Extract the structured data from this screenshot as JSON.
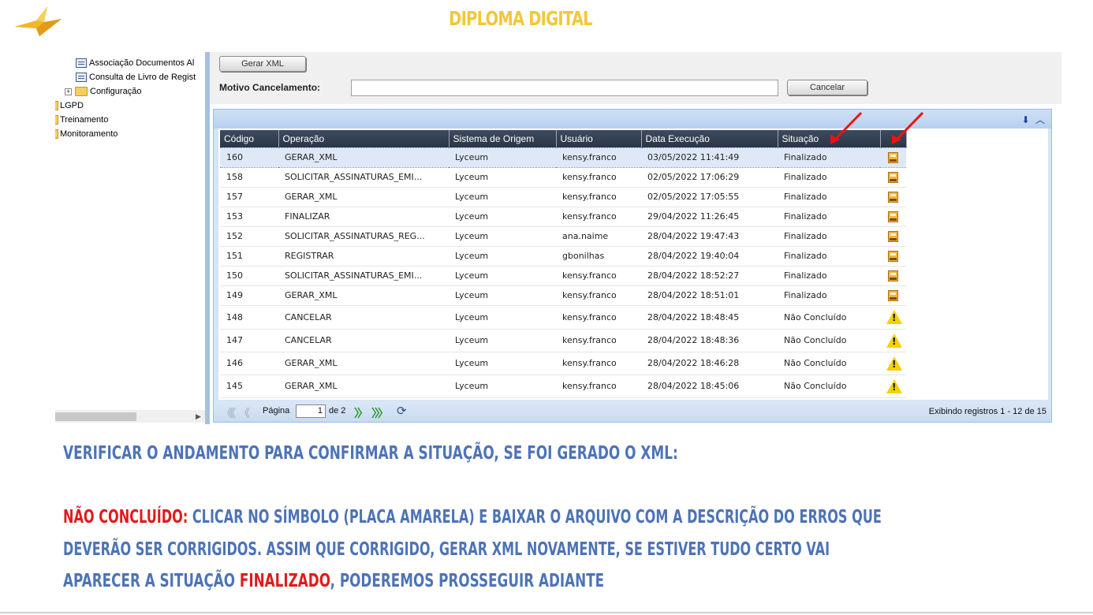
{
  "slide": {
    "title": "DIPLOMA DIGITAL",
    "logo_icon": "bird-icon",
    "title_color": "#f3c738",
    "text_color": "#4d73b8",
    "highlight_color": "#e01b1b"
  },
  "sidebar": {
    "items": [
      {
        "label": "Associação Documentos Al",
        "icon": "document-list-icon"
      },
      {
        "label": "Consulta de Livro de Regist",
        "icon": "document-list-icon"
      },
      {
        "label": "Configuração",
        "icon": "folder-icon"
      },
      {
        "label": "LGPD",
        "icon": "folder-icon"
      },
      {
        "label": "Treinamento",
        "icon": "folder-icon"
      },
      {
        "label": "Monitoramento",
        "icon": "folder-icon"
      }
    ]
  },
  "form": {
    "gerar_xml_label": "Gerar XML",
    "motivo_label": "Motivo Cancelamento:",
    "motivo_value": "",
    "cancelar_label": "Cancelar"
  },
  "grid": {
    "columns": [
      "Código",
      "Operação",
      "Sistema de Origem",
      "Usuário",
      "Data Execução",
      "Situação",
      ""
    ],
    "rows": [
      {
        "codigo": "160",
        "operacao": "GERAR_XML",
        "sistema": "Lyceum",
        "usuario": "kensy.franco",
        "data": "03/05/2022 11:41:49",
        "situacao": "Finalizado",
        "icon": "save-file-icon"
      },
      {
        "codigo": "158",
        "operacao": "SOLICITAR_ASSINATURAS_EMI...",
        "sistema": "Lyceum",
        "usuario": "kensy.franco",
        "data": "02/05/2022 17:06:29",
        "situacao": "Finalizado",
        "icon": "save-file-icon"
      },
      {
        "codigo": "157",
        "operacao": "GERAR_XML",
        "sistema": "Lyceum",
        "usuario": "kensy.franco",
        "data": "02/05/2022 17:05:55",
        "situacao": "Finalizado",
        "icon": "save-file-icon"
      },
      {
        "codigo": "153",
        "operacao": "FINALIZAR",
        "sistema": "Lyceum",
        "usuario": "kensy.franco",
        "data": "29/04/2022 11:26:45",
        "situacao": "Finalizado",
        "icon": "save-file-icon"
      },
      {
        "codigo": "152",
        "operacao": "SOLICITAR_ASSINATURAS_REG...",
        "sistema": "Lyceum",
        "usuario": "ana.naime",
        "data": "28/04/2022 19:47:43",
        "situacao": "Finalizado",
        "icon": "save-file-icon"
      },
      {
        "codigo": "151",
        "operacao": "REGISTRAR",
        "sistema": "Lyceum",
        "usuario": "gbonilhas",
        "data": "28/04/2022 19:40:04",
        "situacao": "Finalizado",
        "icon": "save-file-icon"
      },
      {
        "codigo": "150",
        "operacao": "SOLICITAR_ASSINATURAS_EMI...",
        "sistema": "Lyceum",
        "usuario": "kensy.franco",
        "data": "28/04/2022 18:52:27",
        "situacao": "Finalizado",
        "icon": "save-file-icon"
      },
      {
        "codigo": "149",
        "operacao": "GERAR_XML",
        "sistema": "Lyceum",
        "usuario": "kensy.franco",
        "data": "28/04/2022 18:51:01",
        "situacao": "Finalizado",
        "icon": "save-file-icon"
      },
      {
        "codigo": "148",
        "operacao": "CANCELAR",
        "sistema": "Lyceum",
        "usuario": "kensy.franco",
        "data": "28/04/2022 18:48:45",
        "situacao": "Não Concluído",
        "icon": "warning-icon"
      },
      {
        "codigo": "147",
        "operacao": "CANCELAR",
        "sistema": "Lyceum",
        "usuario": "kensy.franco",
        "data": "28/04/2022 18:48:36",
        "situacao": "Não Concluído",
        "icon": "warning-icon"
      },
      {
        "codigo": "146",
        "operacao": "GERAR_XML",
        "sistema": "Lyceum",
        "usuario": "kensy.franco",
        "data": "28/04/2022 18:46:28",
        "situacao": "Não Concluído",
        "icon": "warning-icon"
      },
      {
        "codigo": "145",
        "operacao": "GERAR_XML",
        "sistema": "Lyceum",
        "usuario": "kensy.franco",
        "data": "28/04/2022 18:45:06",
        "situacao": "Não Concluído",
        "icon": "warning-icon"
      }
    ]
  },
  "pager": {
    "page_label": "Página",
    "page_value": "1",
    "of_label": "de 2",
    "summary": "Exibindo registros 1 - 12 de 15"
  },
  "captions": {
    "line1": "VERIFICAR O ANDAMENTO PARA CONFIRMAR A SITUAÇÃO, SE FOI GERADO O XML:",
    "nao_concluido": "NÃO CONCLUÍDO:",
    "line2_rest": " CLICAR NO SÍMBOLO (PLACA AMARELA) E BAIXAR O ARQUIVO COM A DESCRIÇÃO DO ERROS QUE",
    "line3": "DEVERÃO SER CORRIGIDOS. ASSIM QUE CORRIGIDO, GERAR XML NOVAMENTE, SE ESTIVER TUDO CERTO VAI",
    "line4_start": "APARECER A SITUAÇÃO ",
    "finalizado": "FINALIZADO",
    "line4_end": ", PODEREMOS PROSSEGUIR ADIANTE"
  }
}
